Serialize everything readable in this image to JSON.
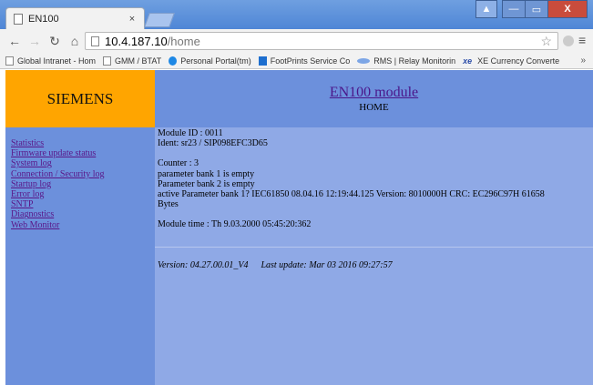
{
  "browser": {
    "tab_title": "EN100",
    "tab_close": "×",
    "url_host": "10.4.187.10",
    "url_path": "/home",
    "bookmarks": [
      {
        "label": "Global Intranet - Hom",
        "icon": "page-icon"
      },
      {
        "label": "GMM / BTAT",
        "icon": "page-icon"
      },
      {
        "label": "Personal Portal(tm)",
        "icon": "portal-icon"
      },
      {
        "label": "FootPrints Service Co",
        "icon": "footprints-icon"
      },
      {
        "label": "RMS | Relay Monitorin",
        "icon": "rms-icon"
      },
      {
        "label": "XE Currency Converte",
        "icon": "xe-icon",
        "icon_text": "xe"
      }
    ],
    "more_bookmarks": "»"
  },
  "header": {
    "brand": "SIEMENS",
    "module_title": "EN100 module",
    "subtitle": "HOME"
  },
  "sidebar": {
    "links": [
      "Statistics",
      "Firmware update status",
      "System log",
      "Connection / Security log",
      "Startup log",
      "Error log",
      "SNTP",
      "Diagnostics",
      "Web Monitor"
    ]
  },
  "content": {
    "module_id": "Module ID : 0011",
    "ident": "Ident: sr23 / SIP098EFC3D65",
    "counter": "Counter : 3",
    "bank1": "parameter bank 1 is empty",
    "bank2": "Parameter bank 2 is empty",
    "active_bank": "active Parameter bank 1? IEC61850 08.04.16 12:19:44.125 Version: 8010000H CRC: EC296C97H 61658",
    "active_bank_cont": "Bytes",
    "module_time": "Module time : Th 9.03.2000 05:45:20:362",
    "version": "Version: 04.27.00.01_V4",
    "last_update": "Last update: Mar 03 2016 09:27:57"
  },
  "colors": {
    "logo_bg": "#ffa500",
    "nav_bg": "#6c90dc",
    "content_bg": "#8fa9e6",
    "link": "#5a1688"
  }
}
